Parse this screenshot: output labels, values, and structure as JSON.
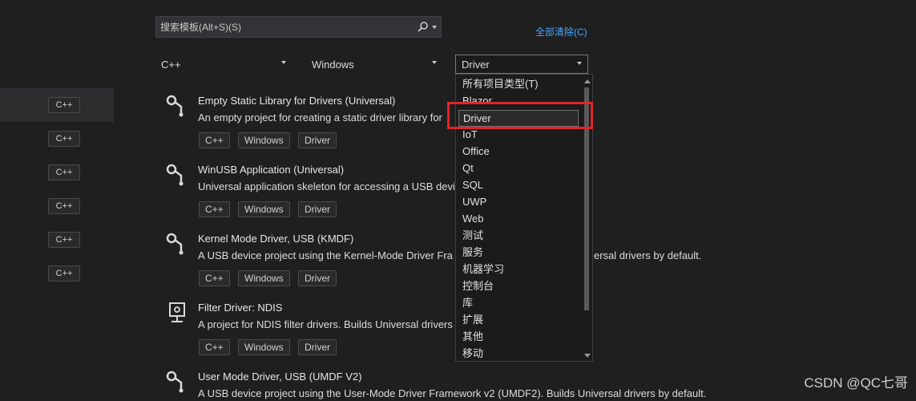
{
  "search": {
    "placeholder": "搜索模板(Alt+S)(S)"
  },
  "clear_all_label": "全部清除(C)",
  "filters": {
    "language": "C++",
    "platform": "Windows",
    "project_type": "Driver"
  },
  "recent_tags": [
    "C++",
    "C++",
    "C++",
    "C++",
    "C++",
    "C++"
  ],
  "templates": [
    {
      "title": "Empty Static Library for Drivers (Universal)",
      "desc": "An empty project for creating a static driver library for",
      "tags": [
        "C++",
        "Windows",
        "Driver"
      ]
    },
    {
      "title": "WinUSB Application (Universal)",
      "desc": "Universal application skeleton for accessing a USB devi",
      "tags": [
        "C++",
        "Windows",
        "Driver"
      ]
    },
    {
      "title": "Kernel Mode Driver, USB (KMDF)",
      "desc": "A USB device project using the Kernel-Mode Driver Fra",
      "desc_tail": "ersal drivers by default.",
      "tags": [
        "C++",
        "Windows",
        "Driver"
      ]
    },
    {
      "title": "Filter Driver: NDIS",
      "desc": "A project for NDIS filter drivers. Builds Universal drivers",
      "tags": [
        "C++",
        "Windows",
        "Driver"
      ]
    },
    {
      "title": "User Mode Driver, USB (UMDF V2)",
      "desc": "A USB device project using the User-Mode Driver Framework v2 (UMDF2). Builds Universal drivers by default.",
      "tags": []
    }
  ],
  "dropdown": {
    "options": [
      "所有项目类型(T)",
      "Blazor",
      "Driver",
      "IoT",
      "Office",
      "Qt",
      "SQL",
      "UWP",
      "Web",
      "测试",
      "服务",
      "机器学习",
      "控制台",
      "库",
      "扩展",
      "其他",
      "移动"
    ],
    "selected_index": 2
  },
  "watermark": "CSDN @QC七哥",
  "colors": {
    "background": "#1f1f1f",
    "link": "#4aa3ff",
    "highlight": "#e2242b"
  }
}
